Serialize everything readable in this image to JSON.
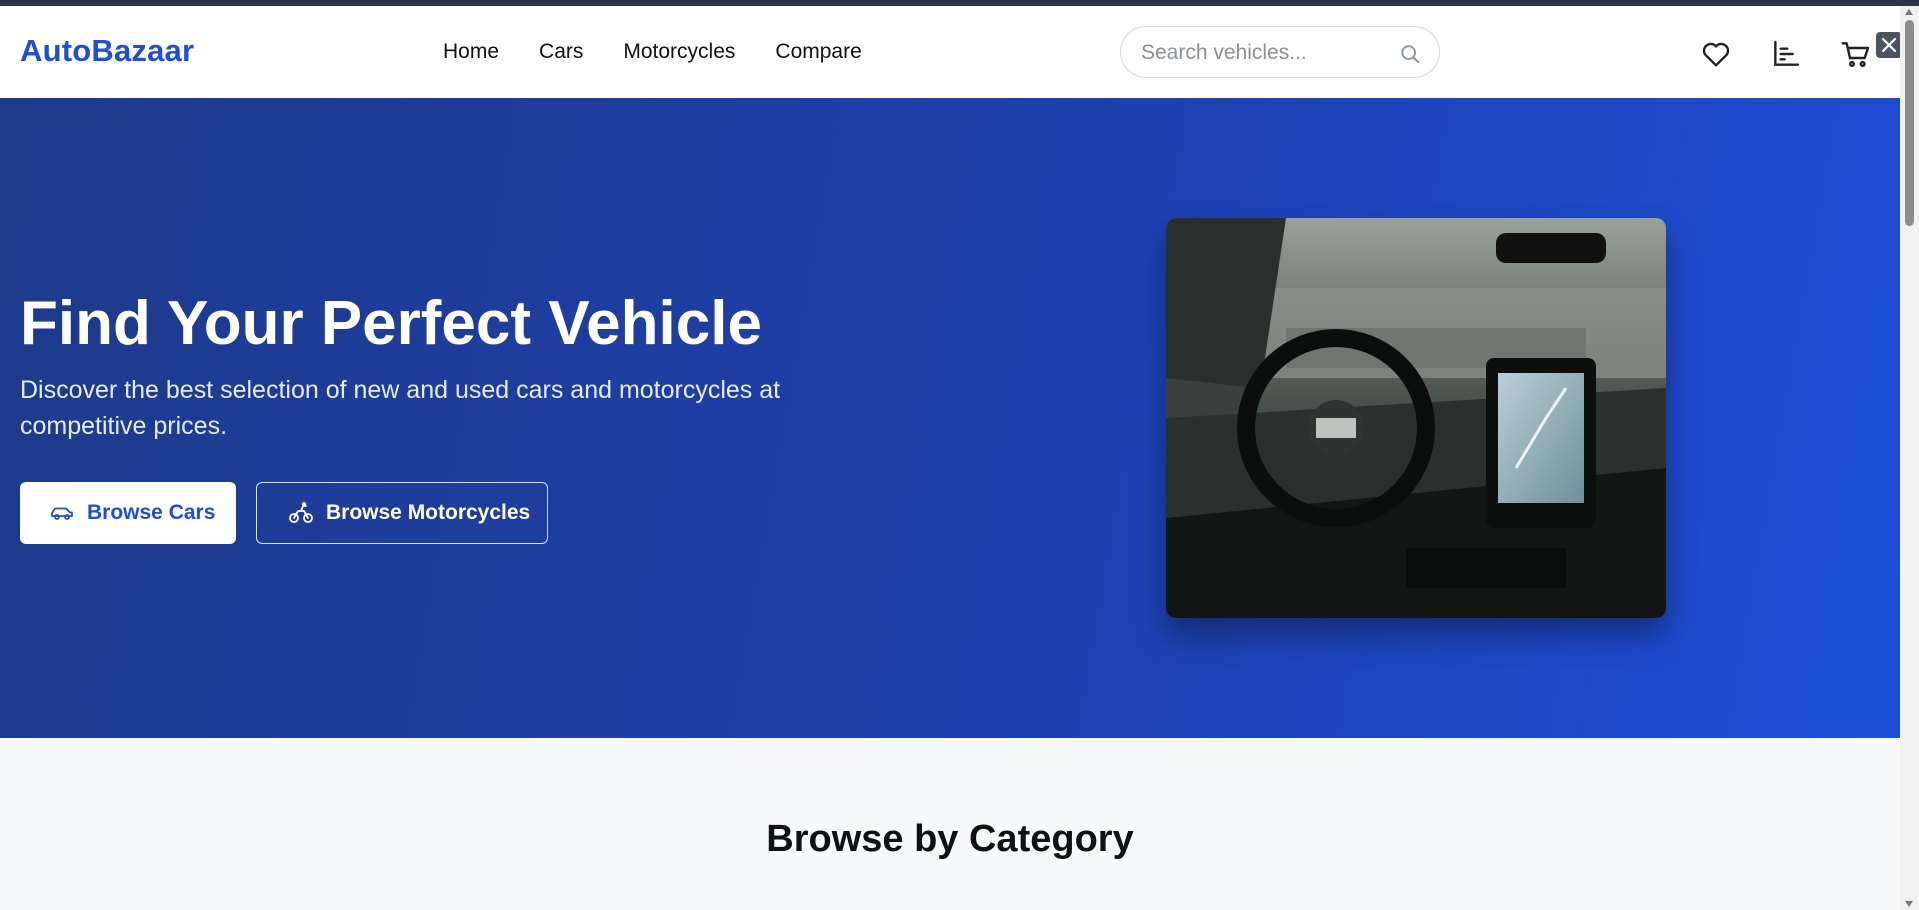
{
  "header": {
    "logo": "AutoBazaar",
    "nav": [
      "Home",
      "Cars",
      "Motorcycles",
      "Compare"
    ],
    "search_placeholder": "Search vehicles...",
    "icons": [
      "heart-icon",
      "compare-chart-icon",
      "cart-icon"
    ]
  },
  "hero": {
    "title": "Find Your Perfect Vehicle",
    "subtitle": "Discover the best selection of new and used cars and motorcycles at competitive prices.",
    "primary_button": "Browse Cars",
    "secondary_button": "Browse Motorcycles",
    "image_alt": "Car interior with steering wheel and touchscreen dashboard"
  },
  "sections": {
    "category_title": "Browse by Category"
  },
  "colors": {
    "brand": "#1d4ed8",
    "hero_start": "#1e3a8a",
    "hero_end": "#1d4ed8",
    "page_bg": "#f8f9fb"
  }
}
